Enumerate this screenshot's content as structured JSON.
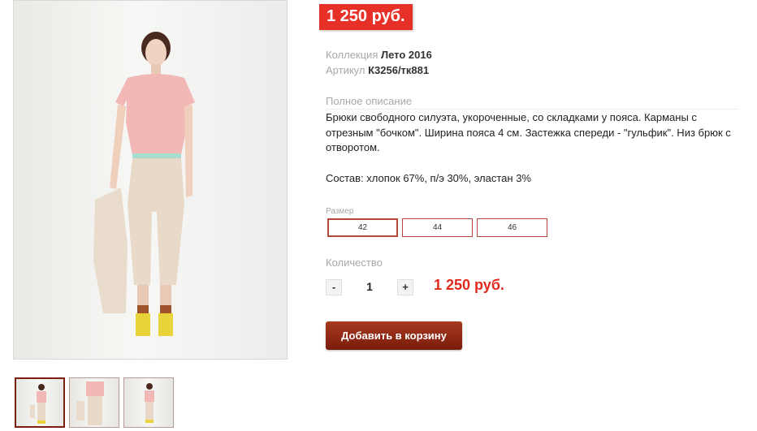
{
  "product": {
    "price_badge": "1 250 руб.",
    "collection_label": "Коллекция",
    "collection_value": "Лето 2016",
    "article_label": "Артикул",
    "article_value": "К3256/тк881",
    "description_title": "Полное описание",
    "description": "Брюки свободного силуэта, укороченные, со складками у пояса. Карманы с отрезным \"бочком\". Ширина пояса 4 см. Застежка спереди - \"гульфик\". Низ брюк с отворотом.",
    "composition": "Состав: хлопок 67%, п/э 30%, эластан 3%"
  },
  "size": {
    "label": "Размер",
    "options": [
      "42",
      "44",
      "46"
    ],
    "selected": "42"
  },
  "quantity": {
    "label": "Количество",
    "minus": "-",
    "value": "1",
    "plus": "+",
    "total": "1 250 руб."
  },
  "cart": {
    "add_label": "Добавить в корзину"
  },
  "colors": {
    "badge": "#e63028",
    "accent_dark": "#7a1c0c",
    "total": "#e02a1e"
  },
  "thumbnails": [
    "model-front",
    "model-front-close",
    "model-back"
  ]
}
